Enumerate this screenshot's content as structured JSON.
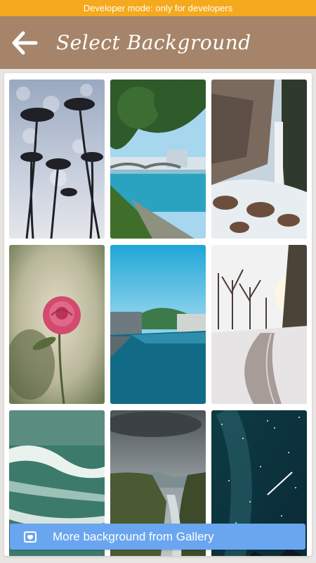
{
  "banner": {
    "text": "Developer mode: only for developers"
  },
  "header": {
    "title": "Select Background",
    "back_icon": "arrow-left-icon"
  },
  "backgrounds": [
    {
      "name": "palm-trees"
    },
    {
      "name": "river-bridge"
    },
    {
      "name": "waterfall"
    },
    {
      "name": "pink-rose"
    },
    {
      "name": "blue-canal"
    },
    {
      "name": "snowy-road"
    },
    {
      "name": "sea-waves"
    },
    {
      "name": "coastal-cliffs"
    },
    {
      "name": "starry-night"
    }
  ],
  "footer": {
    "gallery_label": "More background from Gallery",
    "gallery_icon": "image-frame-icon"
  },
  "colors": {
    "banner": "#f5a91d",
    "header": "#a58469",
    "button": "#6aa6f0"
  }
}
